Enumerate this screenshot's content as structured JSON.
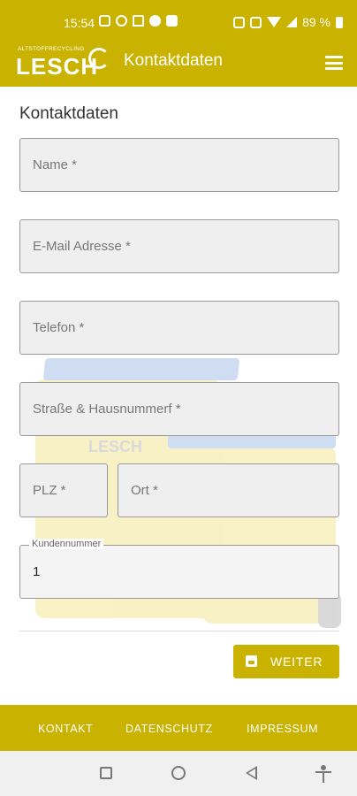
{
  "status_bar": {
    "time": "15:54",
    "battery": "89 %",
    "left_icons": [
      "calendar-icon",
      "check-circle-icon",
      "home-icon",
      "record-icon",
      "image-icon"
    ],
    "right_icons": [
      "data-icon",
      "volte-icon",
      "wifi-icon",
      "signal-icon",
      "battery-icon"
    ]
  },
  "app_bar": {
    "logo_small": "ALTSTOFFRECYCLING",
    "logo_big": "LESCH",
    "title": "Kontaktdaten",
    "menu_icon": "hamburger-menu-icon"
  },
  "form": {
    "heading": "Kontaktdaten",
    "name_placeholder": "Name *",
    "email_placeholder": "E-Mail Adresse *",
    "phone_placeholder": "Telefon *",
    "street_placeholder": "Straße & Hausnummerf *",
    "zip_placeholder": "PLZ *",
    "city_placeholder": "Ort *",
    "customer_label": "Kundennummer",
    "customer_value": "1",
    "submit_label": "WEITER",
    "submit_icon": "save-icon"
  },
  "background_art": {
    "watermark_text": "LESCH"
  },
  "footer": {
    "links": [
      "KONTAKT",
      "DATENSCHUTZ",
      "IMPRESSUM"
    ]
  },
  "colors": {
    "brand": "#c9b200",
    "field_bg": "#efefef",
    "field_border": "#999999"
  }
}
